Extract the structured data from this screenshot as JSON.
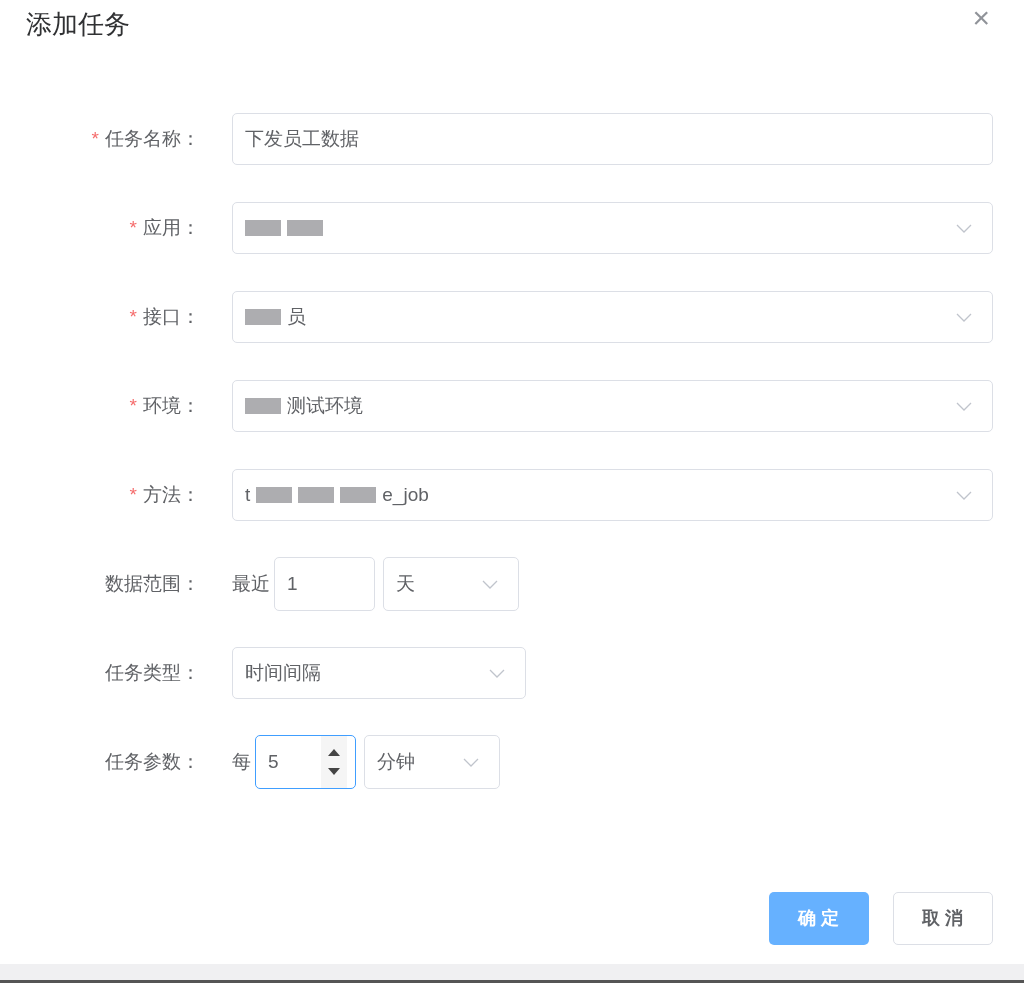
{
  "dialog": {
    "title": "添加任务",
    "close": "×"
  },
  "fields": [
    {
      "kind": "text",
      "label": "任务名称：",
      "required_mark": "*",
      "value": [
        {
          "kind": "text",
          "text": "下发员工数据"
        }
      ]
    },
    {
      "kind": "select",
      "label": "应用：",
      "required_mark": "*",
      "value": [
        {
          "kind": "redacted"
        },
        {
          "kind": "redacted"
        }
      ]
    },
    {
      "kind": "select",
      "label": "接口：",
      "required_mark": "*",
      "value": [
        {
          "kind": "redacted"
        },
        {
          "kind": "text",
          "text": "员"
        }
      ]
    },
    {
      "kind": "select",
      "label": "环境：",
      "required_mark": "*",
      "value": [
        {
          "kind": "redacted"
        },
        {
          "kind": "text",
          "text": "测试环境"
        }
      ]
    },
    {
      "kind": "select",
      "label": "方法：",
      "required_mark": "*",
      "value": [
        {
          "kind": "text",
          "text": "t"
        },
        {
          "kind": "redacted"
        },
        {
          "kind": "redacted"
        },
        {
          "kind": "redacted"
        },
        {
          "kind": "text",
          "text": "e_job"
        }
      ]
    },
    {
      "kind": "range",
      "label": "数据范围：",
      "prefix": "最近",
      "number": "1",
      "focused": false,
      "unit": "天"
    },
    {
      "kind": "short_select",
      "label": "任务类型：",
      "value": [
        {
          "kind": "text",
          "text": "时间间隔"
        }
      ]
    },
    {
      "kind": "stepper",
      "label": "任务参数：",
      "prefix": "每",
      "number": "5",
      "focused": true,
      "unit": "分钟"
    }
  ],
  "buttons": [
    {
      "label": "确 定",
      "primary": true
    },
    {
      "label": "取 消",
      "primary": false
    }
  ]
}
